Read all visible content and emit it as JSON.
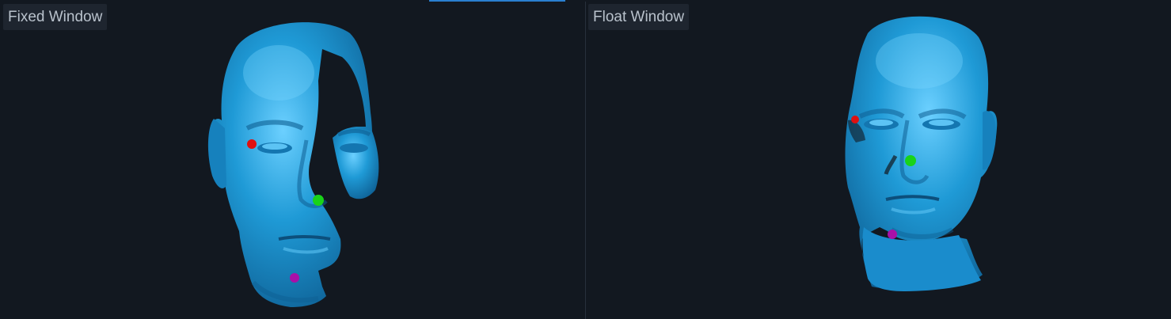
{
  "views": {
    "fixed": {
      "title": "Fixed Window"
    },
    "float": {
      "title": "Float Window"
    }
  },
  "mesh": {
    "color": "#1f9ad6",
    "highlight": "#6cd0ff",
    "shadow": "#0e5f93"
  },
  "landmarks": {
    "eye": {
      "color": "#e01010"
    },
    "nose": {
      "color": "#19d319"
    },
    "chin": {
      "color": "#a810a8"
    }
  },
  "background_color": "#121820"
}
